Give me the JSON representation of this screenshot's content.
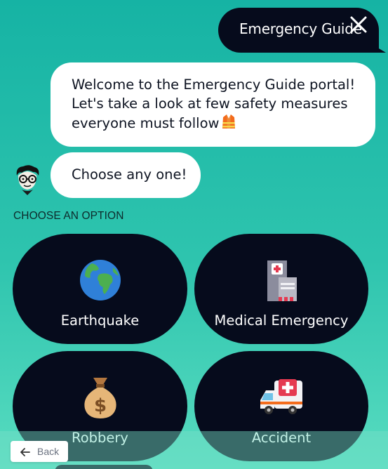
{
  "header": {
    "title": "Emergency Guide",
    "close_icon": "close-icon"
  },
  "messages": [
    {
      "lines": [
        "Welcome to the Emergency Guide portal!",
        "Let's take a look at few safety measures",
        "everyone must follow"
      ],
      "emoji": "safety-vest"
    },
    {
      "text": "Choose any one!"
    }
  ],
  "avatar": "bot-avatar",
  "choose_label": "CHOOSE AN OPTION",
  "options": [
    {
      "label": "Earthquake",
      "icon": "globe-icon"
    },
    {
      "label": "Medical Emergency",
      "icon": "hospital-icon"
    },
    {
      "label": "Robbery",
      "icon": "money-bag-icon"
    },
    {
      "label": "Accident",
      "icon": "ambulance-icon"
    }
  ],
  "footer": {
    "back_label": "Back"
  },
  "colors": {
    "background_top": "#16b3a4",
    "background_bottom": "#58dcc0",
    "dark": "#060b1c",
    "bubble": "#ffffff"
  }
}
